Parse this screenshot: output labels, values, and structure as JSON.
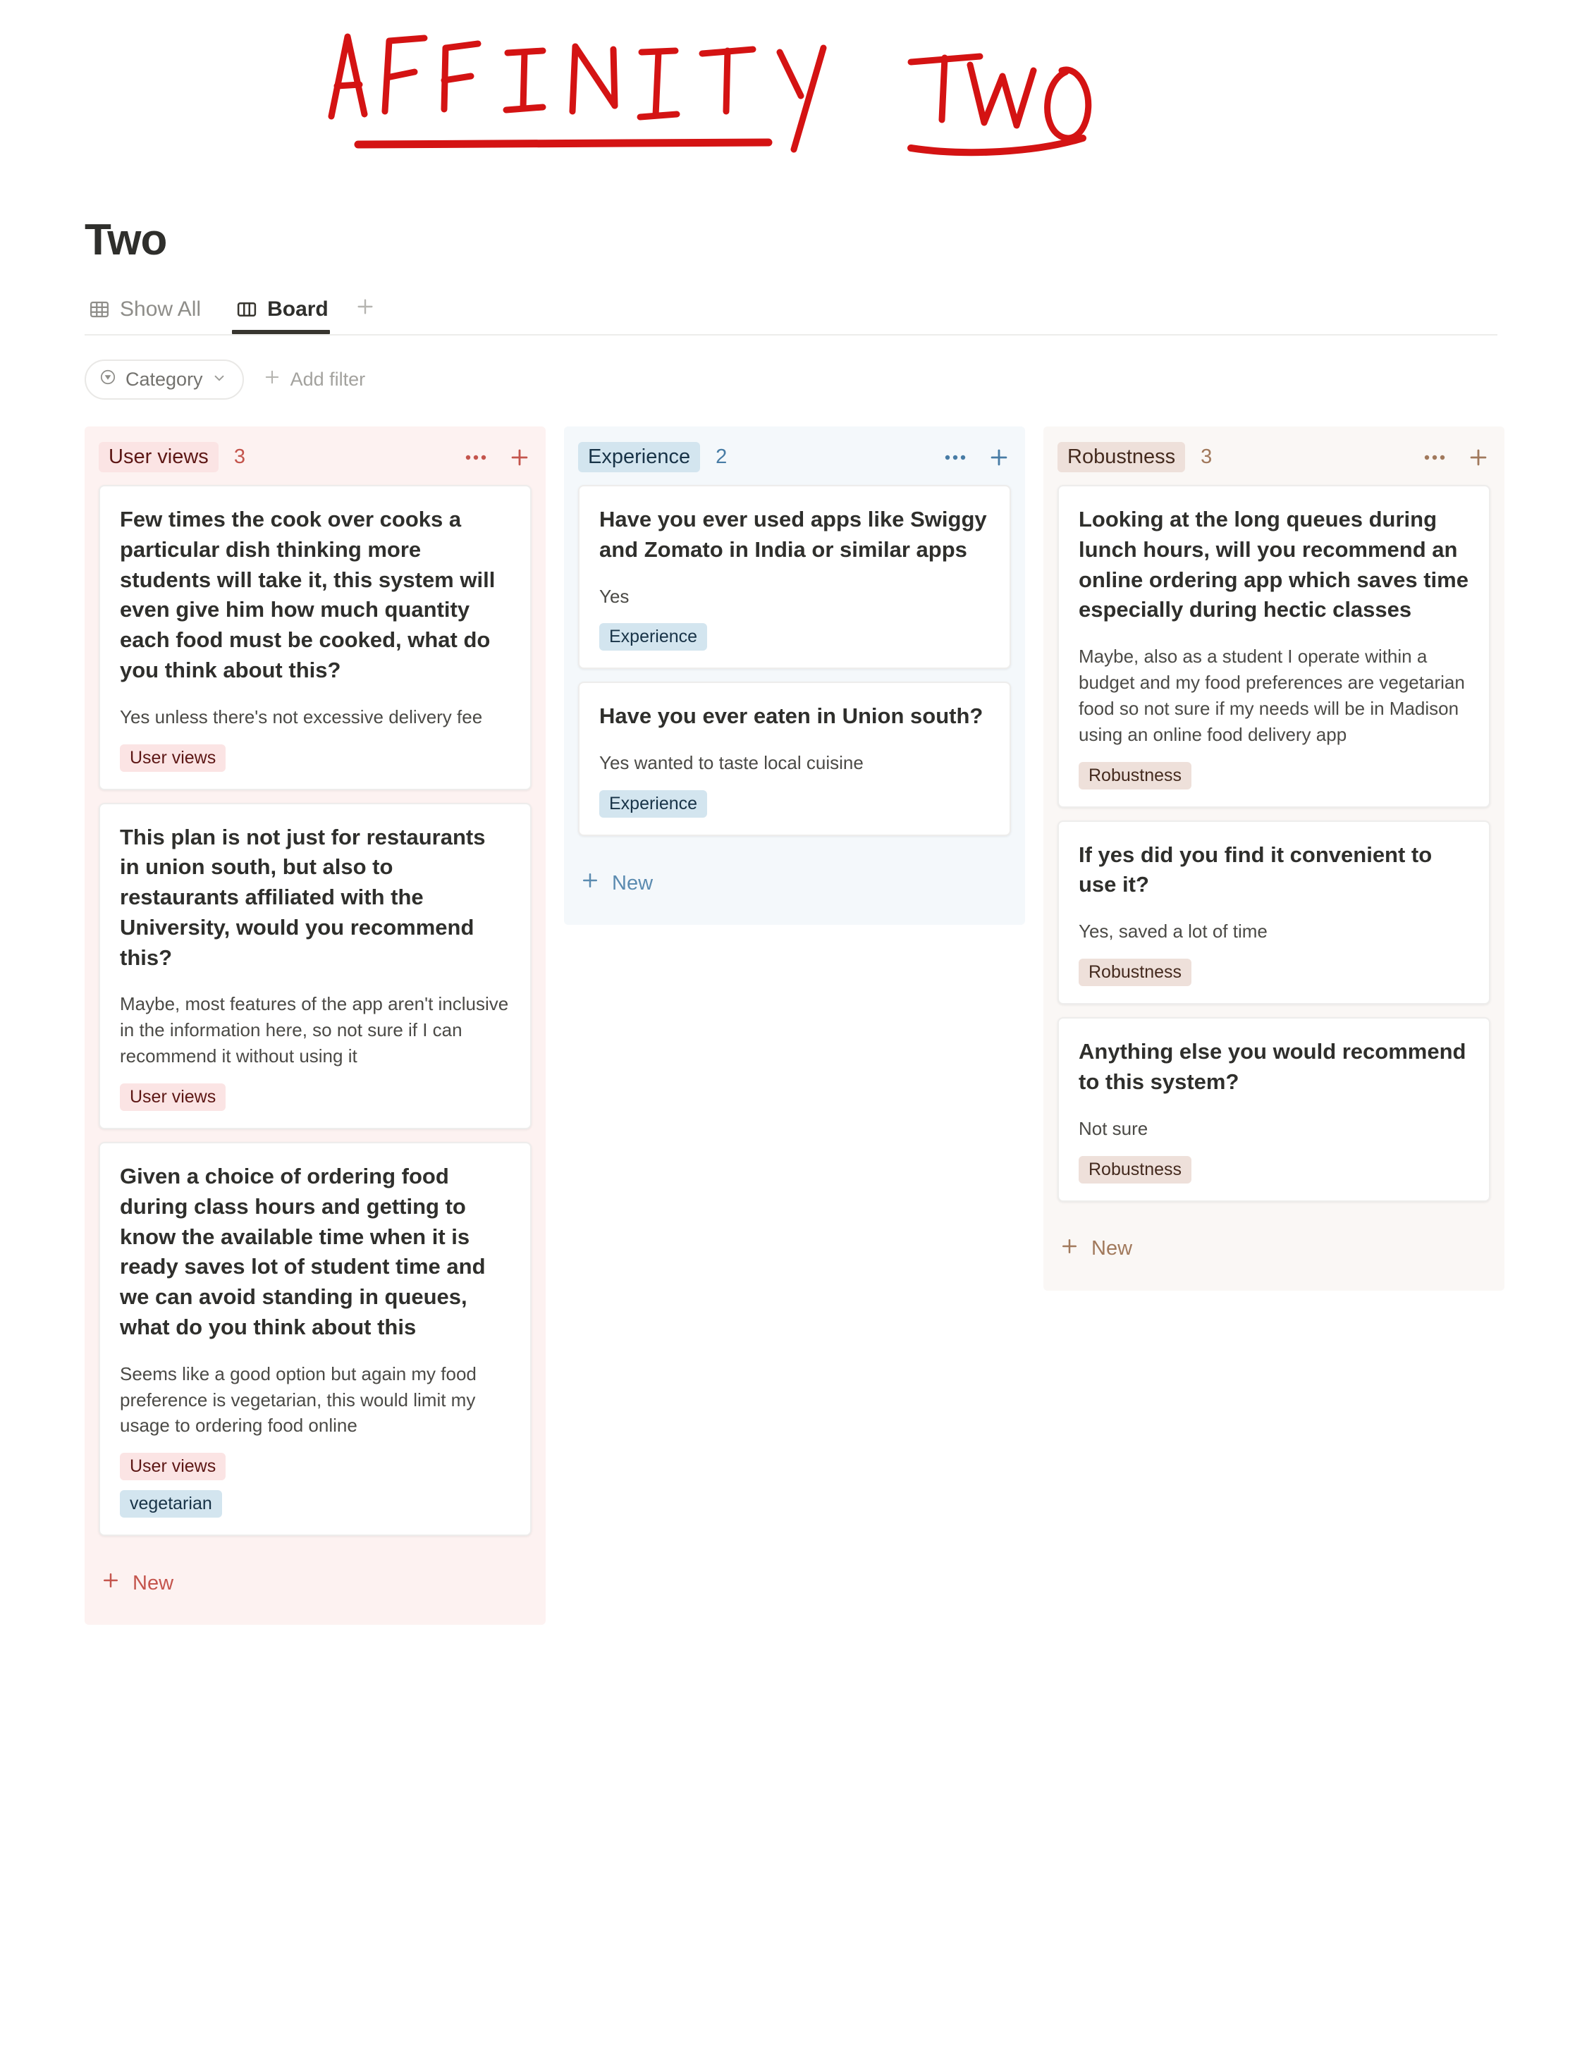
{
  "annotation": {
    "text": "AFFINITY TWO",
    "color": "#d41313",
    "words": [
      "AFFINITY",
      "TWO"
    ]
  },
  "header": {
    "title": "Two"
  },
  "tabs": {
    "items": [
      {
        "label": "Show All",
        "icon": "table-icon",
        "active": false
      },
      {
        "label": "Board",
        "icon": "board-columns-icon",
        "active": true
      }
    ],
    "add_view_icon": "plus-icon"
  },
  "filter_bar": {
    "property_icon": "filter-circle-icon",
    "property_label": "Category",
    "chevron_icon": "chevron-down-icon",
    "add_filter_icon": "plus-icon",
    "add_filter_label": "Add filter"
  },
  "board": {
    "new_label": "New",
    "columns": [
      {
        "name": "User views",
        "count": "3",
        "tag_bg": "#fbe4e4",
        "tag_fg": "#5d1715",
        "count_color": "#c4554d",
        "column_bg": "#fdf2f1",
        "new_color": "#c4554d",
        "more_icon": "ellipsis-icon",
        "add_icon": "plus-icon",
        "cards": [
          {
            "title": "Few times the cook over cooks a particular dish thinking more students will take it, this system will even give him how much quantity each food must be cooked, what do you think about this?",
            "answer": "Yes unless there's not excessive delivery fee",
            "tags": [
              {
                "label": "User views",
                "bg": "#fbe4e4",
                "fg": "#5d1715"
              }
            ]
          },
          {
            "title": "This plan is not just for restaurants in union south, but also to restaurants affiliated with the University, would you recommend this?",
            "answer": "Maybe, most features of the app aren't inclusive in the information here, so not sure if I can recommend it without using it",
            "tags": [
              {
                "label": "User views",
                "bg": "#fbe4e4",
                "fg": "#5d1715"
              }
            ]
          },
          {
            "title": "Given a choice of ordering food during class hours and getting to know the available time when it is ready saves lot of student time and we can avoid standing in queues, what do you think about this",
            "answer": "Seems like a good option but again my food preference is vegetarian, this would limit my usage to ordering food online",
            "tags": [
              {
                "label": "User views",
                "bg": "#fbe4e4",
                "fg": "#5d1715"
              },
              {
                "label": "vegetarian",
                "bg": "#d3e5ef",
                "fg": "#183347"
              }
            ]
          }
        ]
      },
      {
        "name": "Experience",
        "count": "2",
        "tag_bg": "#d3e5ef",
        "tag_fg": "#183347",
        "count_color": "#487ca5",
        "column_bg": "#f4f8fb",
        "new_color": "#5b8bb0",
        "more_icon": "ellipsis-icon",
        "add_icon": "plus-icon",
        "cards": [
          {
            "title": "Have you ever used apps like Swiggy and Zomato in India or similar apps",
            "answer": "Yes",
            "tags": [
              {
                "label": "Experience",
                "bg": "#d3e5ef",
                "fg": "#183347"
              }
            ]
          },
          {
            "title": "Have you ever eaten in Union south?",
            "answer": "Yes wanted to taste local cuisine",
            "tags": [
              {
                "label": "Experience",
                "bg": "#d3e5ef",
                "fg": "#183347"
              }
            ]
          }
        ]
      },
      {
        "name": "Robustness",
        "count": "3",
        "tag_bg": "#eee0da",
        "tag_fg": "#442a1e",
        "count_color": "#a1795c",
        "column_bg": "#faf7f5",
        "new_color": "#a1795c",
        "more_icon": "ellipsis-icon",
        "add_icon": "plus-icon",
        "cards": [
          {
            "title": "Looking at the long queues during lunch hours, will you recommend an online ordering app which saves time especially during hectic classes",
            "answer": "Maybe, also as a student I operate within a budget and my food preferences are vegetarian food so not sure if my needs will be in Madison using an online food delivery app",
            "tags": [
              {
                "label": "Robustness",
                "bg": "#eee0da",
                "fg": "#442a1e"
              }
            ]
          },
          {
            "title": "If yes did you find it convenient to use it?",
            "answer": "Yes, saved a lot of time",
            "tags": [
              {
                "label": "Robustness",
                "bg": "#eee0da",
                "fg": "#442a1e"
              }
            ]
          },
          {
            "title": "Anything else you would recommend to this system?",
            "answer": "Not sure",
            "tags": [
              {
                "label": "Robustness",
                "bg": "#eee0da",
                "fg": "#442a1e"
              }
            ]
          }
        ]
      }
    ]
  }
}
